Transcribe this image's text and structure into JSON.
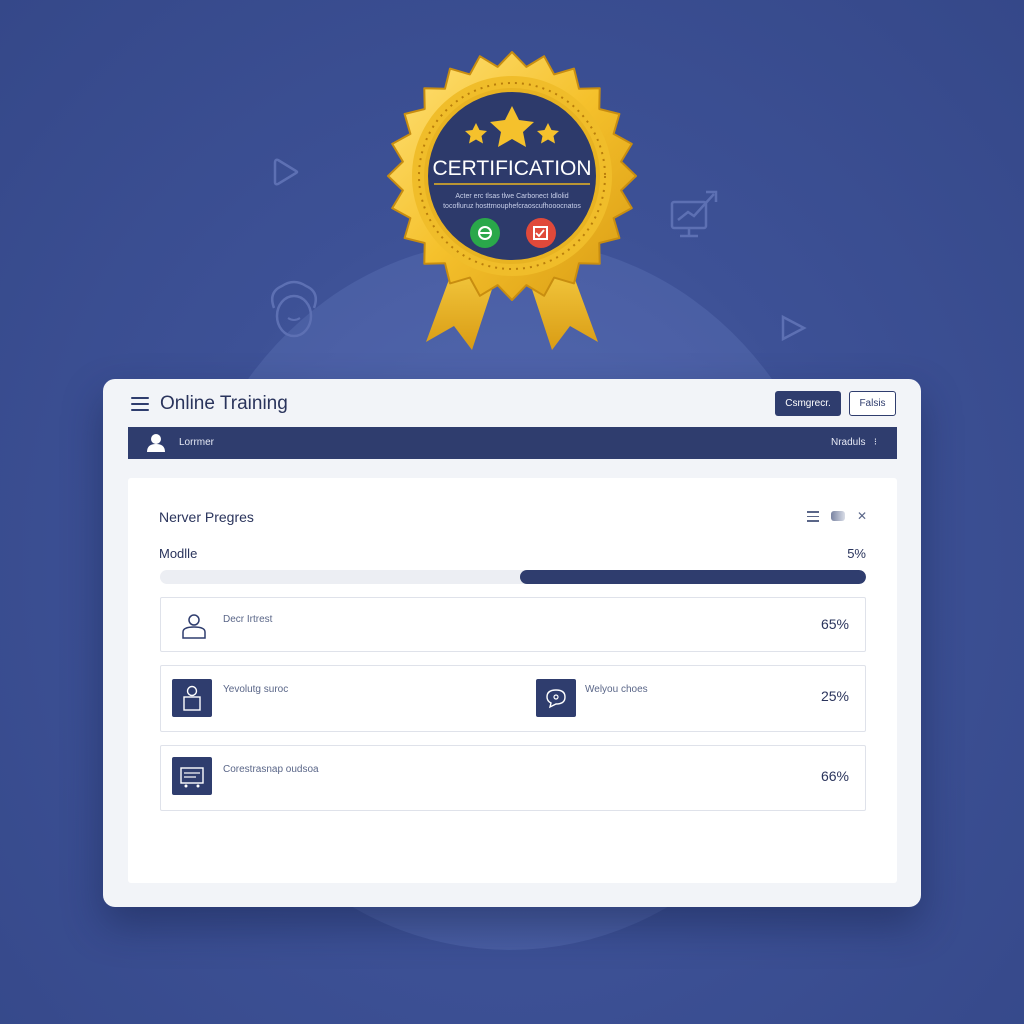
{
  "badge": {
    "title": "CERTIFICATION",
    "subtitle_line1": "Acter erc tlsas tlwe Carbonect Idlolid",
    "subtitle_line2": "tocofluruz hosttrnouphefcraoscufhooocnatos"
  },
  "header": {
    "app_title": "Online Training",
    "primary_button": "Csmgrecr.",
    "secondary_button": "Falsis"
  },
  "userbar": {
    "user_label": "Lorrmer",
    "right_label": "Nraduls",
    "right_chevron": "⁝"
  },
  "panel": {
    "title": "Nerver Pregres",
    "module_label": "Modlle",
    "module_percent_text": "5%",
    "module_progress": 0.49,
    "rows": [
      {
        "label": "Decr Irtrest",
        "percent": "65%"
      },
      {
        "label_left": "Yevolutg suroc",
        "label_right": "Welyou choes",
        "percent": "25%"
      },
      {
        "label": "Corestrasnap oudsoa",
        "percent": "66%"
      }
    ]
  },
  "colors": {
    "background": "#3d5196",
    "navy": "#2f3d6e",
    "gold": "#f2c12e",
    "badge_green": "#2aa84a",
    "badge_red": "#e0493a"
  },
  "icons": {
    "hamburger": "menu-icon",
    "user": "user-icon",
    "list": "list-icon",
    "close": "close-icon"
  }
}
